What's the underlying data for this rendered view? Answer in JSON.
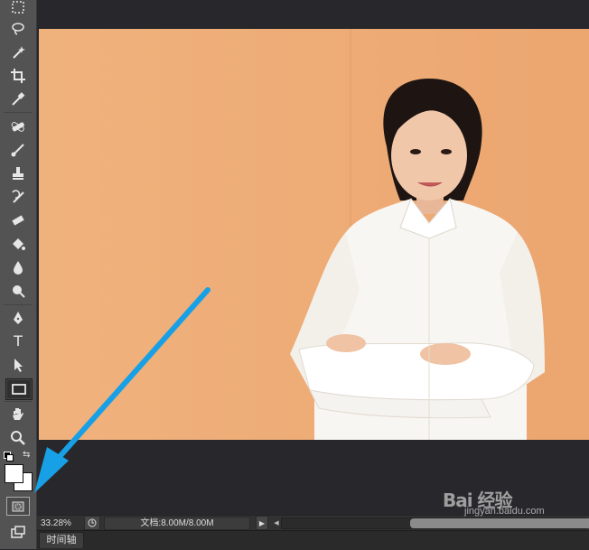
{
  "toolbar": {
    "tools": [
      {
        "name": "rectangular-marquee-icon"
      },
      {
        "name": "lasso-icon"
      },
      {
        "name": "magic-wand-icon"
      },
      {
        "name": "crop-icon"
      },
      {
        "name": "eyedropper-icon"
      },
      {
        "name": "healing-brush-icon"
      },
      {
        "name": "brush-icon"
      },
      {
        "name": "clone-stamp-icon"
      },
      {
        "name": "history-brush-icon"
      },
      {
        "name": "eraser-icon"
      },
      {
        "name": "paint-bucket-icon"
      },
      {
        "name": "blur-icon"
      },
      {
        "name": "dodge-icon"
      },
      {
        "name": "pen-icon"
      },
      {
        "name": "type-icon",
        "glyph": "T"
      },
      {
        "name": "path-selection-icon"
      },
      {
        "name": "rectangle-shape-icon",
        "selected": true
      },
      {
        "name": "hand-icon"
      },
      {
        "name": "zoom-icon"
      },
      {
        "name": "quick-mask-icon",
        "highlighted": true
      },
      {
        "name": "screen-mode-icon"
      }
    ],
    "foreground_color": "#ffffff",
    "background_color": "#ffffff"
  },
  "status": {
    "zoom": "33.28%",
    "doc_info": "文档:8.00M/8.00M"
  },
  "panel": {
    "timeline_tab": "时间轴"
  },
  "watermark": {
    "logo": "Bai 经验",
    "url": "jingyan.baidu.com"
  },
  "colors": {
    "wall": "#eeae78",
    "shirt": "#f8f6f2",
    "arrow": "#18a0e6"
  }
}
